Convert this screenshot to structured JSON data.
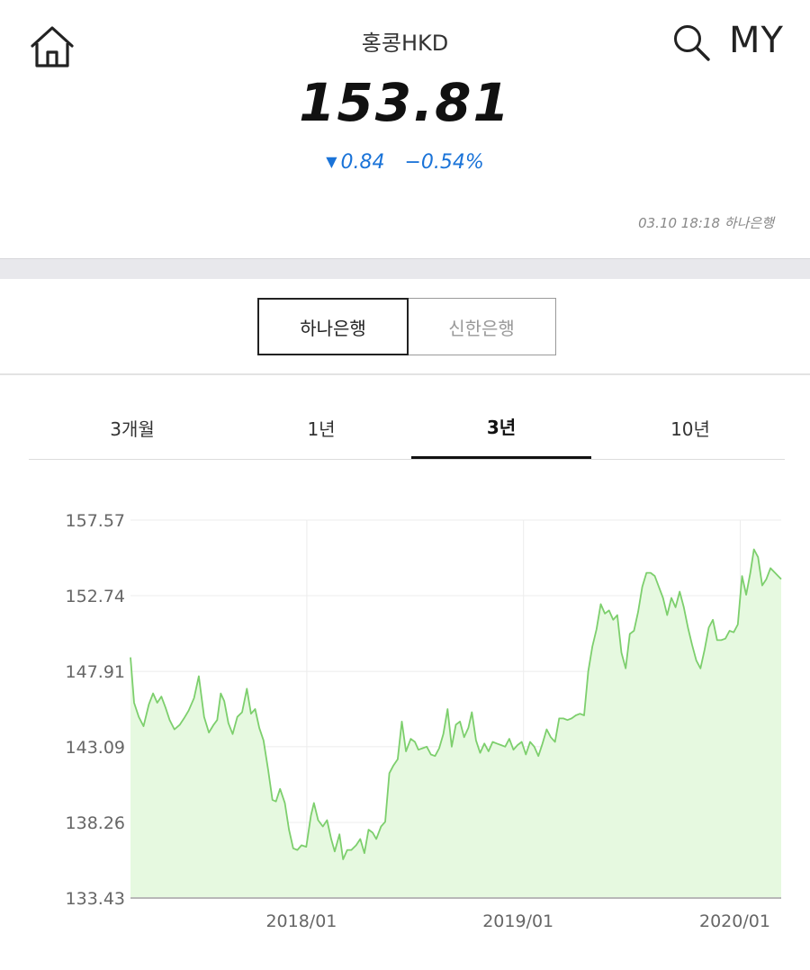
{
  "header": {
    "title": "홍콩HKD",
    "price": "153.81",
    "change_value": "0.84",
    "change_percent": "−0.54%",
    "timestamp": "03.10 18:18 하나은행",
    "my_label": "MY",
    "home_icon": "home-icon",
    "search_icon": "search-icon",
    "down_color": "#1a73d8"
  },
  "bank_tabs": {
    "active": "하나은행",
    "inactive": "신한은행"
  },
  "period_tabs": {
    "items": [
      "3개월",
      "1년",
      "3년",
      "10년"
    ],
    "selected": "3년"
  },
  "chart_data": {
    "type": "area",
    "yticks": [
      "157.57",
      "152.74",
      "147.91",
      "143.09",
      "138.26",
      "133.43"
    ],
    "ylim": [
      133.43,
      157.57
    ],
    "xticks": [
      "2018/01",
      "2019/01",
      "2020/01"
    ],
    "xtick_dates": [
      "2018-01-01",
      "2019-01-01",
      "2020-01-01"
    ],
    "xlim": [
      "2017-03-10",
      "2020-03-10"
    ],
    "grid": true,
    "line_color": "#7dcf6d",
    "fill_color": "#e6f9e0",
    "series": [
      {
        "points": [
          [
            "2017-03-10",
            148.8
          ],
          [
            "2017-03-16",
            145.9
          ],
          [
            "2017-03-24",
            145.0
          ],
          [
            "2017-04-01",
            144.4
          ],
          [
            "2017-04-10",
            145.8
          ],
          [
            "2017-04-17",
            146.5
          ],
          [
            "2017-04-24",
            145.9
          ],
          [
            "2017-05-01",
            146.3
          ],
          [
            "2017-05-08",
            145.6
          ],
          [
            "2017-05-15",
            144.8
          ],
          [
            "2017-05-23",
            144.2
          ],
          [
            "2017-06-01",
            144.5
          ],
          [
            "2017-06-08",
            144.9
          ],
          [
            "2017-06-16",
            145.4
          ],
          [
            "2017-06-25",
            146.2
          ],
          [
            "2017-07-03",
            147.6
          ],
          [
            "2017-07-12",
            145.0
          ],
          [
            "2017-07-20",
            144.0
          ],
          [
            "2017-07-28",
            144.5
          ],
          [
            "2017-08-03",
            144.8
          ],
          [
            "2017-08-09",
            146.5
          ],
          [
            "2017-08-15",
            146.0
          ],
          [
            "2017-08-22",
            144.6
          ],
          [
            "2017-08-29",
            143.9
          ],
          [
            "2017-09-06",
            145.0
          ],
          [
            "2017-09-14",
            145.3
          ],
          [
            "2017-09-22",
            146.8
          ],
          [
            "2017-09-29",
            145.2
          ],
          [
            "2017-10-06",
            145.5
          ],
          [
            "2017-10-13",
            144.3
          ],
          [
            "2017-10-20",
            143.5
          ],
          [
            "2017-10-28",
            141.6
          ],
          [
            "2017-11-04",
            139.7
          ],
          [
            "2017-11-10",
            139.6
          ],
          [
            "2017-11-17",
            140.4
          ],
          [
            "2017-11-25",
            139.5
          ],
          [
            "2017-12-02",
            137.8
          ],
          [
            "2017-12-09",
            136.6
          ],
          [
            "2017-12-16",
            136.5
          ],
          [
            "2017-12-23",
            136.8
          ],
          [
            "2017-12-31",
            136.7
          ],
          [
            "2018-01-08",
            138.7
          ],
          [
            "2018-01-13",
            139.5
          ],
          [
            "2018-01-20",
            138.4
          ],
          [
            "2018-01-28",
            138.0
          ],
          [
            "2018-02-04",
            138.4
          ],
          [
            "2018-02-11",
            137.2
          ],
          [
            "2018-02-17",
            136.4
          ],
          [
            "2018-02-25",
            137.5
          ],
          [
            "2018-03-03",
            135.9
          ],
          [
            "2018-03-10",
            136.5
          ],
          [
            "2018-03-17",
            136.5
          ],
          [
            "2018-03-25",
            136.8
          ],
          [
            "2018-04-01",
            137.2
          ],
          [
            "2018-04-08",
            136.3
          ],
          [
            "2018-04-15",
            137.8
          ],
          [
            "2018-04-22",
            137.6
          ],
          [
            "2018-04-28",
            137.2
          ],
          [
            "2018-05-06",
            138.0
          ],
          [
            "2018-05-13",
            138.3
          ],
          [
            "2018-05-20",
            141.4
          ],
          [
            "2018-05-27",
            141.9
          ],
          [
            "2018-06-03",
            142.3
          ],
          [
            "2018-06-10",
            144.7
          ],
          [
            "2018-06-17",
            142.8
          ],
          [
            "2018-06-25",
            143.6
          ],
          [
            "2018-07-02",
            143.4
          ],
          [
            "2018-07-08",
            142.9
          ],
          [
            "2018-07-15",
            143.0
          ],
          [
            "2018-07-22",
            143.1
          ],
          [
            "2018-07-29",
            142.6
          ],
          [
            "2018-08-05",
            142.5
          ],
          [
            "2018-08-12",
            143.0
          ],
          [
            "2018-08-19",
            143.9
          ],
          [
            "2018-08-26",
            145.5
          ],
          [
            "2018-09-02",
            143.1
          ],
          [
            "2018-09-09",
            144.5
          ],
          [
            "2018-09-16",
            144.7
          ],
          [
            "2018-09-23",
            143.7
          ],
          [
            "2018-09-30",
            144.3
          ],
          [
            "2018-10-06",
            145.3
          ],
          [
            "2018-10-13",
            143.5
          ],
          [
            "2018-10-20",
            142.7
          ],
          [
            "2018-10-27",
            143.3
          ],
          [
            "2018-11-03",
            142.8
          ],
          [
            "2018-11-10",
            143.4
          ],
          [
            "2018-11-17",
            143.3
          ],
          [
            "2018-11-24",
            143.2
          ],
          [
            "2018-12-01",
            143.1
          ],
          [
            "2018-12-08",
            143.6
          ],
          [
            "2018-12-15",
            142.9
          ],
          [
            "2018-12-22",
            143.2
          ],
          [
            "2018-12-29",
            143.4
          ],
          [
            "2019-01-05",
            142.6
          ],
          [
            "2019-01-12",
            143.4
          ],
          [
            "2019-01-19",
            143.1
          ],
          [
            "2019-01-26",
            142.5
          ],
          [
            "2019-02-02",
            143.3
          ],
          [
            "2019-02-09",
            144.2
          ],
          [
            "2019-02-16",
            143.7
          ],
          [
            "2019-02-23",
            143.4
          ],
          [
            "2019-03-02",
            144.9
          ],
          [
            "2019-03-09",
            144.9
          ],
          [
            "2019-03-16",
            144.8
          ],
          [
            "2019-03-23",
            144.9
          ],
          [
            "2019-03-30",
            145.1
          ],
          [
            "2019-04-06",
            145.2
          ],
          [
            "2019-04-13",
            145.1
          ],
          [
            "2019-04-20",
            147.9
          ],
          [
            "2019-04-27",
            149.5
          ],
          [
            "2019-05-04",
            150.6
          ],
          [
            "2019-05-11",
            152.2
          ],
          [
            "2019-05-18",
            151.6
          ],
          [
            "2019-05-25",
            151.8
          ],
          [
            "2019-06-01",
            151.2
          ],
          [
            "2019-06-08",
            151.5
          ],
          [
            "2019-06-15",
            149.1
          ],
          [
            "2019-06-22",
            148.1
          ],
          [
            "2019-06-29",
            150.3
          ],
          [
            "2019-07-06",
            150.5
          ],
          [
            "2019-07-13",
            151.7
          ],
          [
            "2019-07-20",
            153.3
          ],
          [
            "2019-07-27",
            154.2
          ],
          [
            "2019-08-03",
            154.2
          ],
          [
            "2019-08-10",
            154.0
          ],
          [
            "2019-08-17",
            153.3
          ],
          [
            "2019-08-24",
            152.6
          ],
          [
            "2019-08-31",
            151.5
          ],
          [
            "2019-09-07",
            152.6
          ],
          [
            "2019-09-14",
            152.0
          ],
          [
            "2019-09-21",
            153.0
          ],
          [
            "2019-09-28",
            152.0
          ],
          [
            "2019-10-05",
            150.7
          ],
          [
            "2019-10-12",
            149.6
          ],
          [
            "2019-10-19",
            148.6
          ],
          [
            "2019-10-26",
            148.1
          ],
          [
            "2019-11-02",
            149.3
          ],
          [
            "2019-11-09",
            150.7
          ],
          [
            "2019-11-16",
            151.2
          ],
          [
            "2019-11-23",
            149.9
          ],
          [
            "2019-11-30",
            149.9
          ],
          [
            "2019-12-07",
            150.0
          ],
          [
            "2019-12-14",
            150.5
          ],
          [
            "2019-12-21",
            150.4
          ],
          [
            "2019-12-28",
            150.9
          ],
          [
            "2020-01-04",
            154.0
          ],
          [
            "2020-01-11",
            152.8
          ],
          [
            "2020-01-18",
            154.2
          ],
          [
            "2020-01-24",
            155.7
          ],
          [
            "2020-01-31",
            155.2
          ],
          [
            "2020-02-07",
            153.4
          ],
          [
            "2020-02-14",
            153.8
          ],
          [
            "2020-02-21",
            154.5
          ],
          [
            "2020-03-10",
            153.8
          ]
        ]
      }
    ]
  }
}
